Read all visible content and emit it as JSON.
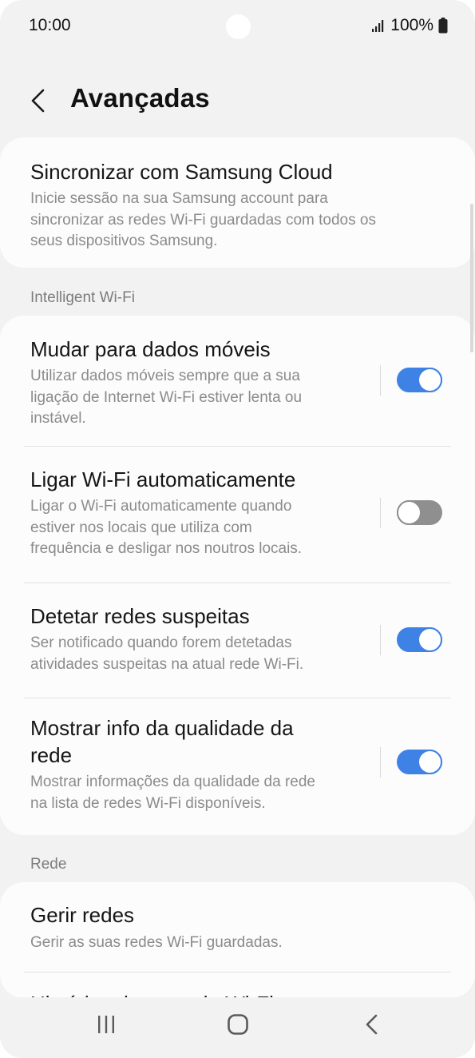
{
  "status_bar": {
    "time": "10:00",
    "battery": "100%",
    "icons": [
      "signal-icon",
      "battery-icon"
    ]
  },
  "header": {
    "title": "Avançadas",
    "back_icon": "chevron-left-icon"
  },
  "cloud": {
    "title": "Sincronizar com Samsung Cloud",
    "subtitle_lines": [
      "Inicie sessão na sua Samsung account para",
      "sincronizar as redes Wi-Fi guardadas com todos os",
      "seus dispositivos Samsung."
    ]
  },
  "sections": {
    "intelligent": "Intelligent Wi-Fi",
    "network": "Rede"
  },
  "intelligent_items": [
    {
      "title_lines": [
        "Mudar para dados móveis"
      ],
      "subtitle_lines": [
        "Utilizar dados móveis sempre que a sua",
        "ligação de Internet Wi-Fi estiver lenta ou",
        "instável."
      ],
      "enabled": true
    },
    {
      "title_lines": [
        "Ligar Wi-Fi automaticamente"
      ],
      "subtitle_lines": [
        "Ligar o Wi-Fi automaticamente quando",
        "estiver nos locais que utiliza com",
        "frequência e desligar nos noutros locais."
      ],
      "enabled": false
    },
    {
      "title_lines": [
        "Detetar redes suspeitas"
      ],
      "subtitle_lines": [
        "Ser notificado quando forem detetadas",
        "atividades suspeitas na atual rede Wi-Fi."
      ],
      "enabled": true
    },
    {
      "title_lines": [
        "Mostrar info da qualidade da",
        "rede"
      ],
      "subtitle_lines": [
        "Mostrar informações da qualidade da rede",
        "na lista de redes Wi-Fi disponíveis."
      ],
      "enabled": true
    }
  ],
  "network_items": [
    {
      "title": "Gerir redes",
      "subtitle": "Gerir as suas redes Wi-Fi guardadas."
    },
    {
      "title": "Histórico de controlo Wi-Fi"
    }
  ],
  "nav_bar": {
    "icons": [
      "recent-apps-icon",
      "home-icon",
      "back-icon"
    ]
  },
  "colors": {
    "toggle_on": "#3e82e5",
    "toggle_off": "#8f8f8f",
    "background": "#f2f2f2",
    "card": "#fcfcfc"
  }
}
